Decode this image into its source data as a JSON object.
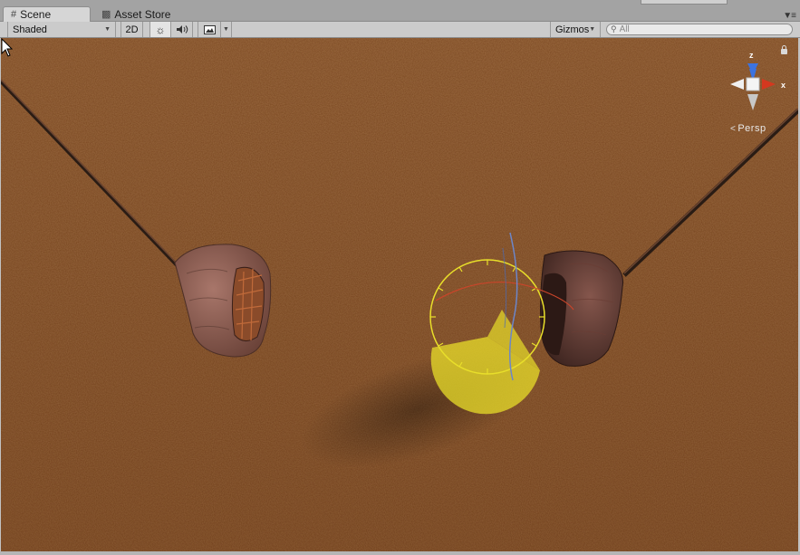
{
  "tabs": [
    {
      "label": "Scene",
      "icon": "grid-icon",
      "active": true
    },
    {
      "label": "Asset Store",
      "icon": "store-icon",
      "active": false
    }
  ],
  "toolbar": {
    "shading_mode": "Shaded",
    "toggle_2d": "2D",
    "gizmos_label": "Gizmos",
    "search_placeholder": "All"
  },
  "gizmo": {
    "axis_z": "z",
    "axis_x": "x",
    "projection": "Persp"
  },
  "colors": {
    "ground": "#8a5a32",
    "axis_x": "#d4381f",
    "axis_y": "#59a52d",
    "axis_z": "#3c73e0",
    "light_gizmo": "#e8de2a"
  }
}
